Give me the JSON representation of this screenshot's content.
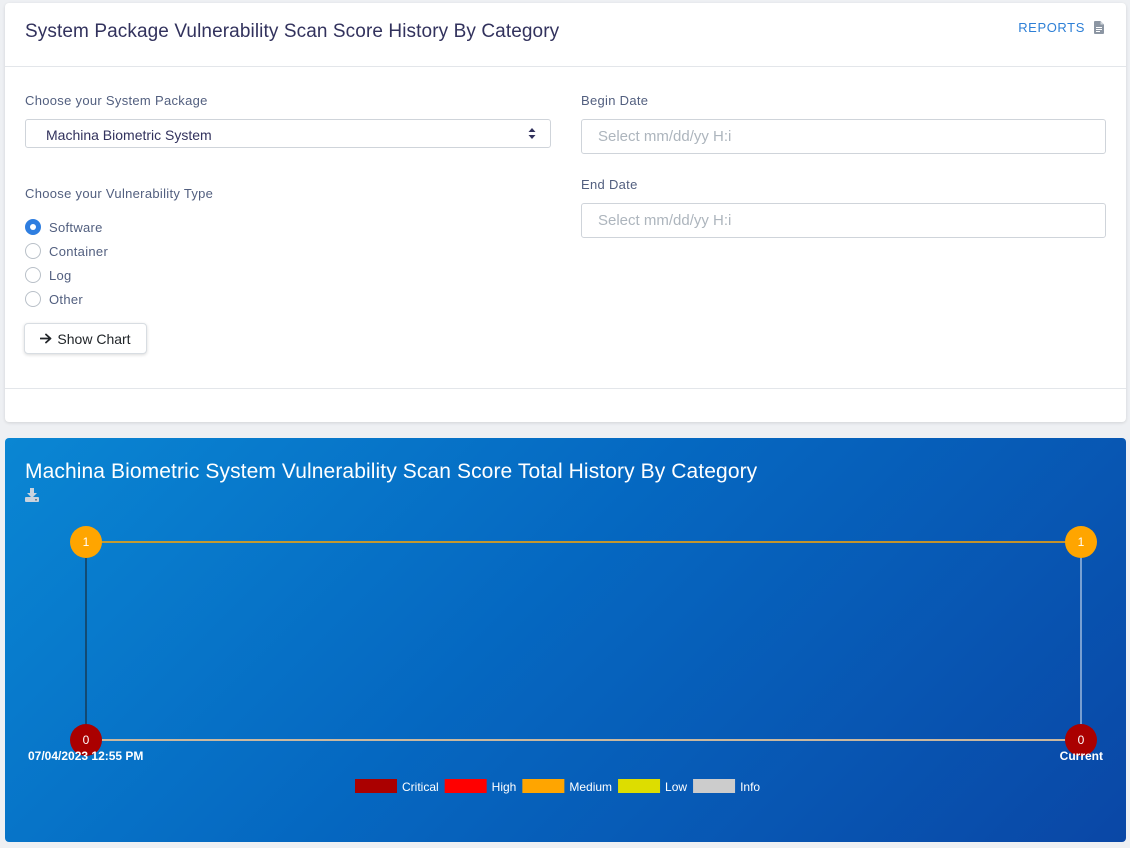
{
  "header": {
    "title": "System Package Vulnerability Scan Score History By Category",
    "reports_label": "REPORTS",
    "reports_icon": "document-icon"
  },
  "form": {
    "package_label": "Choose your System Package",
    "package_selected": "Machina Biometric System",
    "vuln_type_label": "Choose your Vulnerability Type",
    "vuln_types": [
      {
        "label": "Software",
        "checked": true
      },
      {
        "label": "Container",
        "checked": false
      },
      {
        "label": "Log",
        "checked": false
      },
      {
        "label": "Other",
        "checked": false
      }
    ],
    "show_chart_label": "Show Chart",
    "begin_date_label": "Begin Date",
    "begin_date_placeholder": "Select mm/dd/yy H:i",
    "end_date_label": "End Date",
    "end_date_placeholder": "Select mm/dd/yy H:i"
  },
  "chart_card": {
    "title": "Machina Biometric System Vulnerability Scan Score Total History By Category",
    "download_icon": "download-icon"
  },
  "chart_data": {
    "type": "line",
    "title": "Machina Biometric System Vulnerability Scan Score Total History By Category",
    "categories": [
      "07/04/2023 12:55 PM",
      "Current"
    ],
    "ylim": [
      0,
      1
    ],
    "series": [
      {
        "name": "Critical",
        "color": "#aa0000",
        "values": [
          0,
          0
        ]
      },
      {
        "name": "High",
        "color": "#ff0000",
        "values": [
          0,
          0
        ]
      },
      {
        "name": "Medium",
        "color": "#ffa500",
        "values": [
          1,
          1
        ]
      },
      {
        "name": "Low",
        "color": "#dddd00",
        "values": [
          0,
          0
        ]
      },
      {
        "name": "Info",
        "color": "#cccccc",
        "values": [
          0,
          0
        ]
      }
    ],
    "legend_position": "bottom"
  }
}
